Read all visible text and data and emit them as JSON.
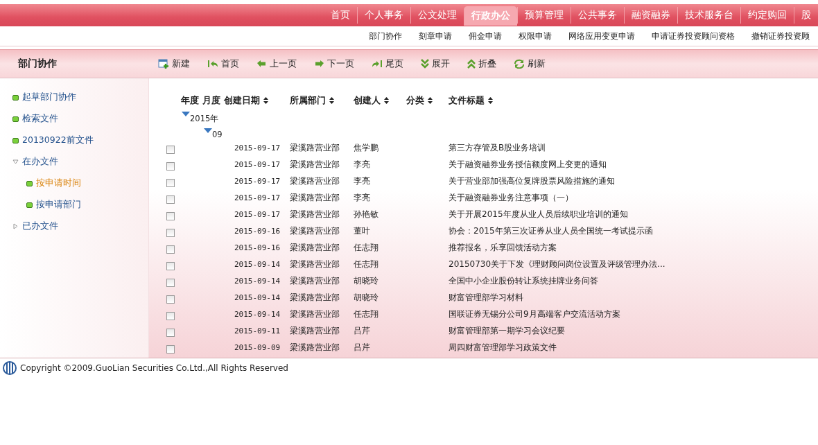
{
  "top_nav": {
    "tabs": [
      {
        "label": "首页",
        "selected": false
      },
      {
        "label": "个人事务",
        "selected": false
      },
      {
        "label": "公文处理",
        "selected": false
      },
      {
        "label": "行政办公",
        "selected": true
      },
      {
        "label": "预算管理",
        "selected": false
      },
      {
        "label": "公共事务",
        "selected": false
      },
      {
        "label": "融资融券",
        "selected": false
      },
      {
        "label": "技术服务台",
        "selected": false
      },
      {
        "label": "约定购回",
        "selected": false
      },
      {
        "label": "股",
        "selected": false
      }
    ]
  },
  "sub_nav": [
    "部门协作",
    "刻章申请",
    "佣金申请",
    "权限申请",
    "网络应用变更申请",
    "申请证券投资顾问资格",
    "撤销证券投资顾"
  ],
  "header": {
    "title": "部门协作",
    "toolbar": [
      {
        "kind": "new",
        "label": "新建"
      },
      {
        "kind": "first",
        "label": "首页"
      },
      {
        "kind": "prev",
        "label": "上一页"
      },
      {
        "kind": "next",
        "label": "下一页"
      },
      {
        "kind": "last",
        "label": "尾页"
      },
      {
        "kind": "expand",
        "label": "展开"
      },
      {
        "kind": "collapse",
        "label": "折叠"
      },
      {
        "kind": "refresh",
        "label": "刷新"
      }
    ]
  },
  "sidebar": {
    "items": [
      {
        "kind": "leaf",
        "label": "起草部门协作",
        "selected": false
      },
      {
        "kind": "leaf",
        "label": "检索文件",
        "selected": false
      },
      {
        "kind": "leaf",
        "label": "20130922前文件",
        "selected": false
      },
      {
        "kind": "folder",
        "label": "在办文件",
        "expanded": true,
        "children": [
          {
            "kind": "leaf",
            "label": "按申请时间",
            "selected": true
          },
          {
            "kind": "leaf",
            "label": "按申请部门",
            "selected": false
          }
        ]
      },
      {
        "kind": "folder",
        "label": "已办文件",
        "expanded": false
      }
    ]
  },
  "table": {
    "columns": [
      {
        "label": "年度",
        "sortable": false
      },
      {
        "label": "月度",
        "sortable": false
      },
      {
        "label": "创建日期",
        "sortable": true
      },
      {
        "label": "所属部门",
        "sortable": true
      },
      {
        "label": "创建人",
        "sortable": true
      },
      {
        "label": "分类",
        "sortable": true
      },
      {
        "label": "文件标题",
        "sortable": true
      }
    ],
    "groups": [
      {
        "label": "2015年",
        "expanded": true,
        "children": [
          {
            "label": "09",
            "expanded": true,
            "rows": [
              {
                "checked": false,
                "date": "2015-09-17",
                "department": "梁溪路营业部",
                "creator": "焦学鹏",
                "title": "第三方存管及B股业务培训"
              },
              {
                "checked": false,
                "date": "2015-09-17",
                "department": "梁溪路营业部",
                "creator": "李亮",
                "title": "关于融资融券业务授信额度网上变更的通知"
              },
              {
                "checked": false,
                "date": "2015-09-17",
                "department": "梁溪路营业部",
                "creator": "李亮",
                "title": "关于营业部加强高位复牌股票风险措施的通知"
              },
              {
                "checked": false,
                "date": "2015-09-17",
                "department": "梁溪路营业部",
                "creator": "李亮",
                "title": "关于融资融券业务注意事项（一）"
              },
              {
                "checked": false,
                "date": "2015-09-17",
                "department": "梁溪路营业部",
                "creator": "孙艳敏",
                "title": "关于开展2015年度从业人员后续职业培训的通知"
              },
              {
                "checked": false,
                "date": "2015-09-16",
                "department": "梁溪路营业部",
                "creator": "董叶",
                "title": "协会：2015年第三次证券从业人员全国统一考试提示函"
              },
              {
                "checked": false,
                "date": "2015-09-16",
                "department": "梁溪路营业部",
                "creator": "任志翔",
                "title": "推荐报名，乐享回馈活动方案"
              },
              {
                "checked": false,
                "date": "2015-09-14",
                "department": "梁溪路营业部",
                "creator": "任志翔",
                "title": "20150730关于下发《理财顾问岗位设置及评级管理办法..."
              },
              {
                "checked": false,
                "date": "2015-09-14",
                "department": "梁溪路营业部",
                "creator": "胡晓玲",
                "title": "全国中小企业股份转让系统挂牌业务问答"
              },
              {
                "checked": false,
                "date": "2015-09-14",
                "department": "梁溪路营业部",
                "creator": "胡晓玲",
                "title": "财富管理部学习材料"
              },
              {
                "checked": false,
                "date": "2015-09-14",
                "department": "梁溪路营业部",
                "creator": "任志翔",
                "title": "国联证券无锡分公司9月高端客户交流活动方案"
              },
              {
                "checked": false,
                "date": "2015-09-11",
                "department": "梁溪路营业部",
                "creator": "吕芹",
                "title": "财富管理部第一期学习会议纪要"
              },
              {
                "checked": false,
                "date": "2015-09-09",
                "department": "梁溪路营业部",
                "creator": "吕芹",
                "title": "周四财富管理部学习政策文件"
              }
            ]
          }
        ]
      }
    ]
  },
  "footer": {
    "copyright": "Copyright ©2009.GuoLian Securities Co.Ltd.,All Rights Reserved"
  }
}
